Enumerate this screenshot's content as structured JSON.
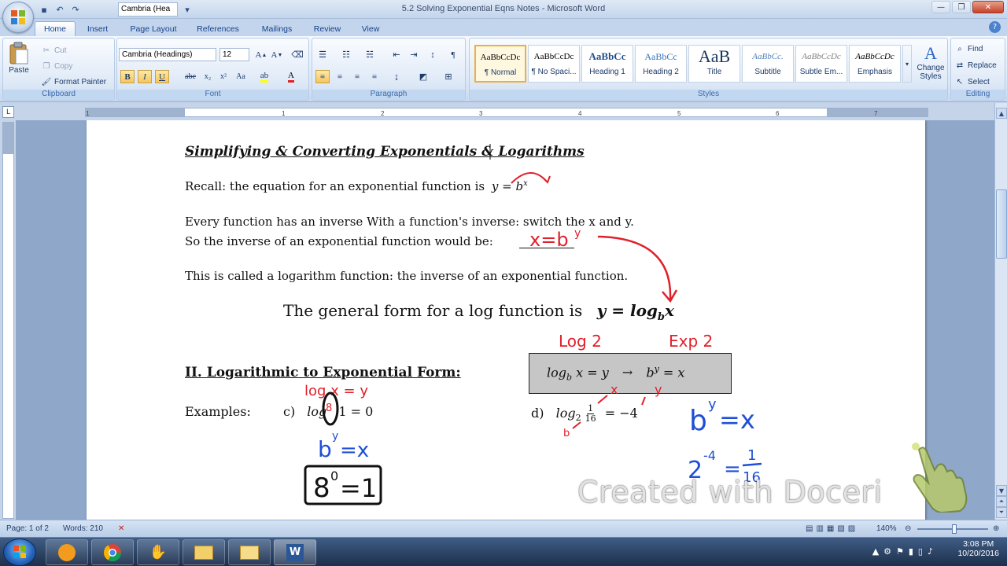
{
  "window": {
    "title": "5.2 Solving Exponential Eqns Notes - Microsoft Word",
    "qat_font": "Cambria (Hea"
  },
  "tabs": [
    "Home",
    "Insert",
    "Page Layout",
    "References",
    "Mailings",
    "Review",
    "View"
  ],
  "ribbon": {
    "clipboard": {
      "label": "Clipboard",
      "paste": "Paste",
      "cut": "Cut",
      "copy": "Copy",
      "format_painter": "Format Painter"
    },
    "font": {
      "label": "Font",
      "font_name": "Cambria (Headings)",
      "font_size": "12"
    },
    "paragraph": {
      "label": "Paragraph"
    },
    "styles": {
      "label": "Styles",
      "tiles": [
        {
          "sample": "AaBbCcDc",
          "name": "¶ Normal"
        },
        {
          "sample": "AaBbCcDc",
          "name": "¶ No Spaci..."
        },
        {
          "sample": "AaBbCc",
          "name": "Heading 1"
        },
        {
          "sample": "AaBbCc",
          "name": "Heading 2"
        },
        {
          "sample": "AaB",
          "name": "Title"
        },
        {
          "sample": "AaBbCc.",
          "name": "Subtitle"
        },
        {
          "sample": "AaBbCcDc",
          "name": "Subtle Em..."
        },
        {
          "sample": "AaBbCcDc",
          "name": "Emphasis"
        }
      ],
      "change_styles": "Change Styles"
    },
    "editing": {
      "label": "Editing",
      "find": "Find",
      "replace": "Replace",
      "select": "Select"
    }
  },
  "document": {
    "heading": "Simplifying & Converting Exponentials & Logarithms",
    "recall": "Recall: the equation for an exponential function is",
    "recall_eq": "y = b",
    "recall_exp": "x",
    "line1": "Every function has an inverse With a function's inverse: switch the x and y.",
    "line2": "So the inverse of an exponential function would  be:",
    "line3": "This is called a logarithm function: the inverse of an exponential function.",
    "general": "The general form for a log function is",
    "general_eq_y": "y = log",
    "general_eq_b": "b",
    "general_eq_x": "x",
    "section": "II. Logarithmic to Exponential Form:",
    "box": {
      "left": "log",
      "sub": "b",
      "mid": "x = y",
      "arrow": "→",
      "right_b": "b",
      "right_sup": "y",
      "right_eq": " = x"
    },
    "examples": "Examples:",
    "ex_c_label": "c)",
    "ex_c": "log",
    "ex_c_rest": "1  =  0",
    "ex_d_label": "d)",
    "ex_d": "log",
    "ex_d_sub": "2",
    "ex_d_num": "1",
    "ex_d_den": "16",
    "ex_d_rest": "=  −4"
  },
  "handwriting": {
    "answer": "x=b",
    "answer_sup": "y",
    "log_label": "Log 2",
    "exp_label": "Exp 2",
    "c_note": "log x = y",
    "c_blue": "b",
    "c_blue_sup": "y",
    "c_blue_rest": "=x",
    "c_box": "8",
    "c_box_sup": "0",
    "c_box_rest": "=1",
    "d_blue": "b",
    "d_blue_sup": "y",
    "d_blue_rest": "=x",
    "d_blue2": "2",
    "d_blue2_sup": "-4",
    "d_blue2_rest": "=",
    "d_frac_num": "1",
    "d_frac_den": "16",
    "x_mark": "x",
    "y_mark": "y",
    "b_mark": "b",
    "c_b_mark": "8",
    "ink_red": "#e0202a",
    "ink_blue": "#1f4fd6",
    "ink_black": "#000000"
  },
  "ruler_numbers": [
    "1",
    "1",
    "2",
    "3",
    "4",
    "5",
    "6",
    "7"
  ],
  "status": {
    "page": "Page: 1 of 2",
    "words": "Words: 210",
    "zoom": "140%"
  },
  "taskbar": {
    "time": "3:08 PM",
    "date": "10/20/2016"
  },
  "watermark": "Created with Doceri"
}
